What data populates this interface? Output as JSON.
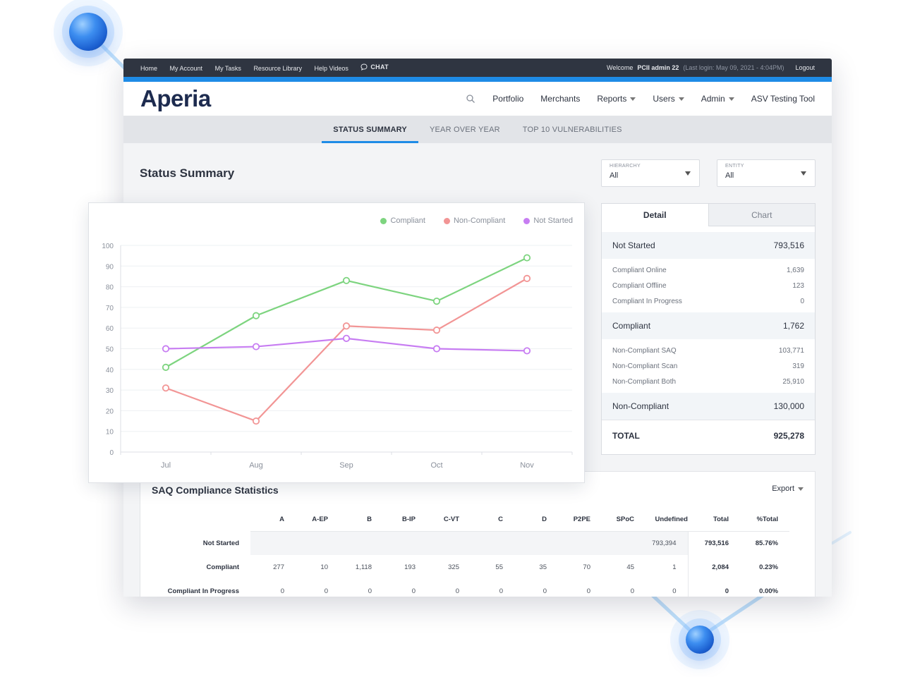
{
  "topbar": {
    "nav": [
      "Home",
      "My Account",
      "My Tasks",
      "Resource Library",
      "Help Videos"
    ],
    "chat_label": "CHAT",
    "welcome": "Welcome",
    "user": "PCII admin 22",
    "last_login": "(Last login: May 09, 2021 - 4:04PM)",
    "logout": "Logout"
  },
  "header": {
    "logo": "Aperia",
    "nav": [
      {
        "label": "Portfolio",
        "dropdown": false
      },
      {
        "label": "Merchants",
        "dropdown": false
      },
      {
        "label": "Reports",
        "dropdown": true
      },
      {
        "label": "Users",
        "dropdown": true
      },
      {
        "label": "Admin",
        "dropdown": true
      },
      {
        "label": "ASV Testing Tool",
        "dropdown": false
      }
    ]
  },
  "tabs": [
    {
      "label": "STATUS SUMMARY",
      "active": true
    },
    {
      "label": "YEAR OVER YEAR",
      "active": false
    },
    {
      "label": "TOP 10 VULNERABILITIES",
      "active": false
    }
  ],
  "page_title": "Status Summary",
  "filters": {
    "hierarchy": {
      "label": "HIERARCHY",
      "value": "All"
    },
    "entity": {
      "label": "ENTITY",
      "value": "All"
    }
  },
  "detail": {
    "tabs": [
      "Detail",
      "Chart"
    ],
    "not_started": {
      "label": "Not Started",
      "value": "793,516"
    },
    "compliant_items": [
      {
        "label": "Compliant Online",
        "value": "1,639"
      },
      {
        "label": "Compliant Offline",
        "value": "123"
      },
      {
        "label": "Compliant In Progress",
        "value": "0"
      }
    ],
    "compliant": {
      "label": "Compliant",
      "value": "1,762"
    },
    "noncompliant_items": [
      {
        "label": "Non-Compliant SAQ",
        "value": "103,771"
      },
      {
        "label": "Non-Compliant Scan",
        "value": "319"
      },
      {
        "label": "Non-Compliant Both",
        "value": "25,910"
      }
    ],
    "noncompliant": {
      "label": "Non-Compliant",
      "value": "130,000"
    },
    "total": {
      "label": "TOTAL",
      "value": "925,278"
    }
  },
  "saq": {
    "title": "SAQ Compliance Statistics",
    "export": "Export",
    "columns": [
      "A",
      "A-EP",
      "B",
      "B-IP",
      "C-VT",
      "C",
      "D",
      "P2PE",
      "SPoC",
      "Undefined",
      "Total",
      "%Total"
    ],
    "rows": [
      {
        "label": "Not Started",
        "cells": [
          "",
          "",
          "",
          "",
          "",
          "",
          "",
          "",
          "",
          "793,394",
          "793,516",
          "85.76%"
        ]
      },
      {
        "label": "Compliant",
        "cells": [
          "277",
          "10",
          "1,118",
          "193",
          "325",
          "55",
          "35",
          "70",
          "45",
          "1",
          "2,084",
          "0.23%"
        ]
      },
      {
        "label": "Compliant In Progress",
        "cells": [
          "0",
          "0",
          "0",
          "0",
          "0",
          "0",
          "0",
          "0",
          "0",
          "0",
          "0",
          "0.00%"
        ]
      }
    ]
  },
  "chart_data": {
    "type": "line",
    "categories": [
      "Jul",
      "Aug",
      "Sep",
      "Oct",
      "Nov"
    ],
    "series": [
      {
        "name": "Compliant",
        "color": "#7dd47f",
        "values": [
          41,
          66,
          83,
          73,
          94
        ]
      },
      {
        "name": "Non-Compliant",
        "color": "#f29595",
        "values": [
          31,
          15,
          61,
          59,
          84
        ]
      },
      {
        "name": "Not Started",
        "color": "#c77df2",
        "values": [
          50,
          51,
          55,
          50,
          49
        ]
      }
    ],
    "ylim": [
      0,
      100
    ],
    "yticks": [
      0,
      10,
      20,
      30,
      40,
      50,
      60,
      70,
      80,
      90,
      100
    ],
    "grid": true,
    "legend": "top-right"
  }
}
